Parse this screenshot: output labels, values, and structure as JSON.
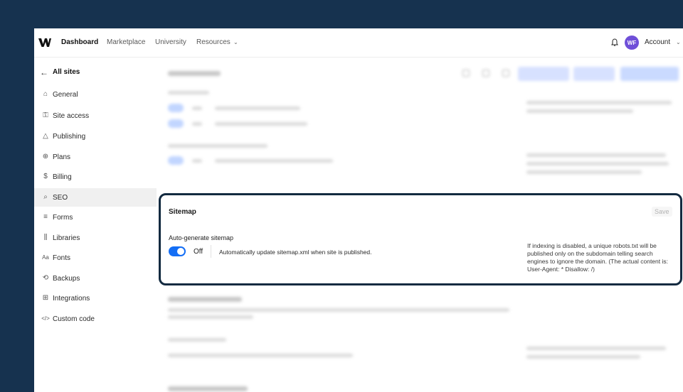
{
  "nav": {
    "items": [
      {
        "label": "Dashboard",
        "active": true
      },
      {
        "label": "Marketplace",
        "active": false
      },
      {
        "label": "University",
        "active": false
      },
      {
        "label": "Resources",
        "active": false
      }
    ],
    "account_label": "Account",
    "avatar_initials": "WF"
  },
  "sidebar": {
    "back_label": "All sites",
    "items": [
      {
        "label": "General",
        "icon": "home-icon",
        "glyph": "⌂"
      },
      {
        "label": "Site access",
        "icon": "key-icon",
        "glyph": "⚿"
      },
      {
        "label": "Publishing",
        "icon": "publish-icon",
        "glyph": "△"
      },
      {
        "label": "Plans",
        "icon": "plans-icon",
        "glyph": "⊕"
      },
      {
        "label": "Billing",
        "icon": "dollar-icon",
        "glyph": "$"
      },
      {
        "label": "SEO",
        "icon": "search-icon",
        "glyph": "⌕",
        "active": true
      },
      {
        "label": "Forms",
        "icon": "forms-icon",
        "glyph": "≡"
      },
      {
        "label": "Libraries",
        "icon": "libraries-icon",
        "glyph": "⫼"
      },
      {
        "label": "Fonts",
        "icon": "fonts-icon",
        "glyph": "Aa"
      },
      {
        "label": "Backups",
        "icon": "backups-icon",
        "glyph": "⟲"
      },
      {
        "label": "Integrations",
        "icon": "integrations-icon",
        "glyph": "⊞"
      },
      {
        "label": "Custom code",
        "icon": "code-icon",
        "glyph": "</>"
      }
    ]
  },
  "sitemap": {
    "title": "Sitemap",
    "save_label": "Save",
    "auto_label": "Auto-generate sitemap",
    "toggle_state": "Off",
    "description": "Automatically update sitemap.xml when site is published.",
    "note": "If indexing is disabled, a unique robots.txt will be published only on the subdomain telling search engines to ignore the domain. (The actual content is: User-Agent: * Disallow: /)"
  },
  "colors": {
    "accent": "#146ef5",
    "backdrop": "#16324f",
    "card_border": "#132a40",
    "avatar": "#6f4fd8"
  }
}
